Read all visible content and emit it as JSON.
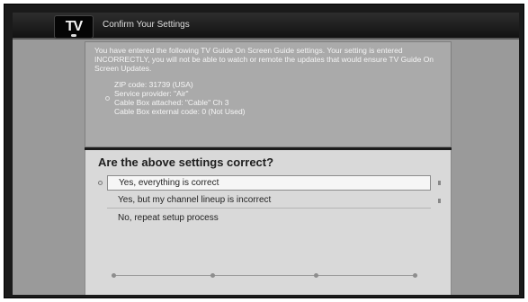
{
  "header": {
    "logo_text": "TV",
    "title": "Confirm Your Settings"
  },
  "summary": {
    "intro": "You have entered the following TV Guide On Screen Guide settings. Your setting is entered INCORRECTLY, you will not be able to watch or remote the updates that would ensure TV Guide On Screen Updates.",
    "settings": [
      "ZIP code: 31739 (USA)",
      "Service provider: \"Air\"",
      "Cable Box attached: \"Cable\" Ch 3",
      "Cable Box external code: 0 (Not Used)"
    ]
  },
  "question": {
    "text": "Are the above settings correct?",
    "options": [
      "Yes, everything is correct",
      "Yes, but my channel lineup is incorrect",
      "No, repeat setup process"
    ]
  }
}
